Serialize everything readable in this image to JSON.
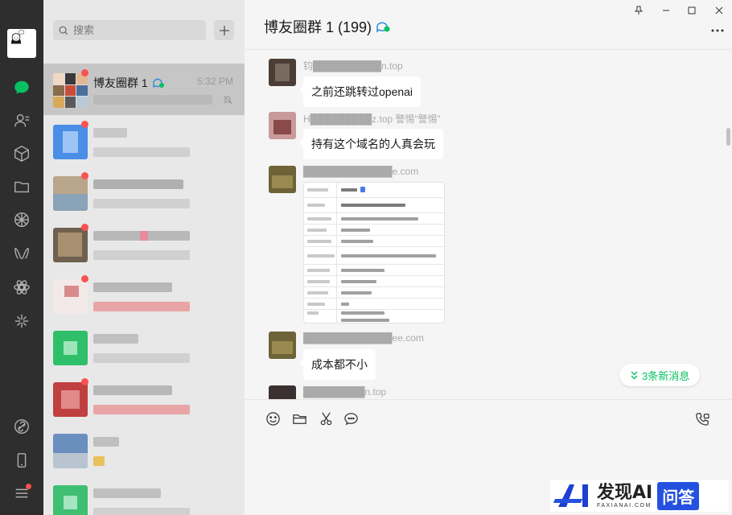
{
  "sidebar": {
    "icons": [
      "chat-icon",
      "contacts-icon",
      "cube-icon",
      "folder-icon",
      "moments-icon",
      "channels-icon",
      "mini-program-icon",
      "search-lite-icon",
      "link-icon",
      "phone-icon",
      "menu-icon"
    ]
  },
  "search": {
    "placeholder": "搜索"
  },
  "chat_list": [
    {
      "name": "博友圈群 1",
      "time": "5:32 PM",
      "preview": "████████████",
      "muted": true,
      "unread": true
    },
    {
      "name": "████",
      "time": "",
      "preview": "████████",
      "unread": true
    },
    {
      "name": "████████",
      "time": "",
      "preview": "████████",
      "unread": true
    },
    {
      "name": "████████",
      "time": "",
      "preview": "████████",
      "unread": true
    },
    {
      "name": "████████",
      "time": "",
      "preview": "████████",
      "unread": true
    },
    {
      "name": "████",
      "time": "",
      "preview": "████████",
      "unread": false
    },
    {
      "name": "████████",
      "time": "",
      "preview": "████████",
      "unread": true
    },
    {
      "name": "███",
      "time": "",
      "preview": "█",
      "unread": false
    },
    {
      "name": "██████",
      "time": "",
      "preview": "████████",
      "unread": false
    }
  ],
  "chat": {
    "title": "博友圈群 1 (199)",
    "messages": [
      {
        "sender": "钧██████████n.top",
        "type": "text",
        "text": "之前还跳转过openai"
      },
      {
        "sender": "H█████████z.top 警惕“警惕”",
        "type": "text",
        "text": "持有这个域名的人真会玩"
      },
      {
        "sender": "█████████████e.com",
        "type": "image",
        "text": ""
      },
      {
        "sender": "█████████████ee.com",
        "type": "text",
        "text": "成本都不小"
      },
      {
        "sender": "█████████n.top",
        "type": "text",
        "text": ""
      }
    ],
    "new_messages_label": "3条新消息"
  },
  "window_controls": [
    "pin-icon",
    "minimize-icon",
    "maximize-icon",
    "close-icon"
  ],
  "input_tools": [
    "emoji-icon",
    "folder-icon",
    "scissors-icon",
    "chat-history-icon",
    "voice-call-icon"
  ],
  "watermark": {
    "main": "发现AI",
    "sub": "FAXIANAI.COM",
    "tag": "问答"
  },
  "colors": {
    "accent": "#07c160",
    "sidebar": "#2e2e2e",
    "list_bg": "#e8e8e8",
    "selected": "#c6c6c6",
    "badge": "#fa5151"
  }
}
